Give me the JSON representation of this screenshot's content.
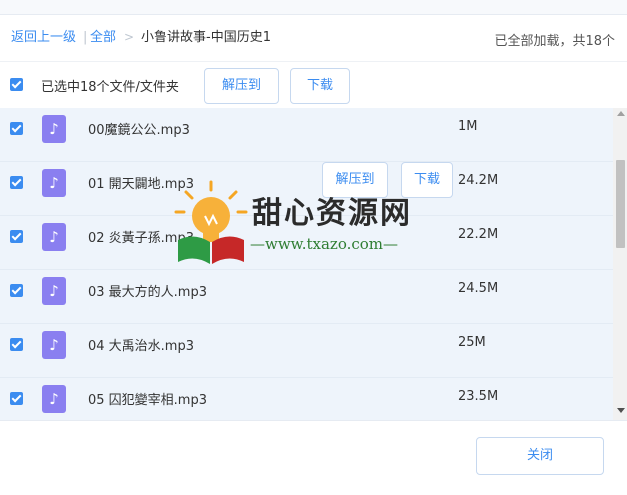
{
  "breadcrumb": {
    "back_label": "返回上一级",
    "all_label": "全部",
    "separator": ">",
    "current": "小鲁讲故事-中国历史1"
  },
  "status": "已全部加载，共18个",
  "selection": {
    "label": "已选中18个文件/文件夹",
    "extract_label": "解压到",
    "download_label": "下载"
  },
  "files": [
    {
      "name": "00魔鏡公公.mp3",
      "size": "1M"
    },
    {
      "name": "01 開天闢地.mp3",
      "size": "24.2M"
    },
    {
      "name": "02 炎黃子孫.mp3",
      "size": "22.2M"
    },
    {
      "name": "03 最大方的人.mp3",
      "size": "24.5M"
    },
    {
      "name": "04 大禹治水.mp3",
      "size": "25M"
    },
    {
      "name": "05 囚犯變宰相.mp3",
      "size": "23.5M"
    }
  ],
  "row_actions": {
    "extract_label": "解压到",
    "download_label": "下载"
  },
  "footer": {
    "close_label": "关闭"
  },
  "watermark": {
    "title": "甜心资源网",
    "url": "—www.txazo.com—"
  },
  "colors": {
    "accent": "#3b8cf0",
    "file_icon": "#8a7ff0",
    "row_bg": "#eef4fb"
  },
  "icons": {
    "file": "music-note-icon",
    "check": "checkbox-checked-icon"
  }
}
